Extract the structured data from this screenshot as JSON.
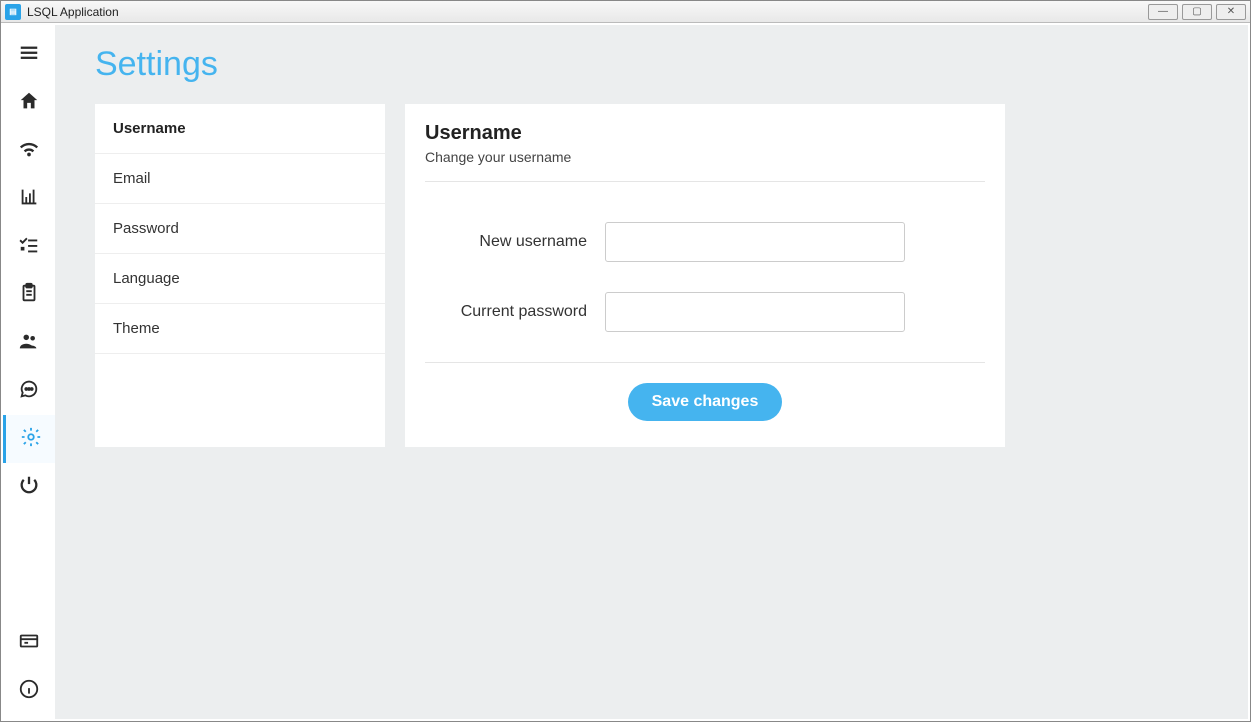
{
  "window": {
    "title": "LSQL Application"
  },
  "page": {
    "title": "Settings"
  },
  "settings_menu": {
    "items": [
      {
        "label": "Username",
        "active": true
      },
      {
        "label": "Email",
        "active": false
      },
      {
        "label": "Password",
        "active": false
      },
      {
        "label": "Language",
        "active": false
      },
      {
        "label": "Theme",
        "active": false
      }
    ]
  },
  "panel": {
    "title": "Username",
    "description": "Change your username",
    "fields": {
      "new_username": {
        "label": "New username",
        "value": ""
      },
      "current_password": {
        "label": "Current password",
        "value": ""
      }
    },
    "save_label": "Save changes"
  }
}
